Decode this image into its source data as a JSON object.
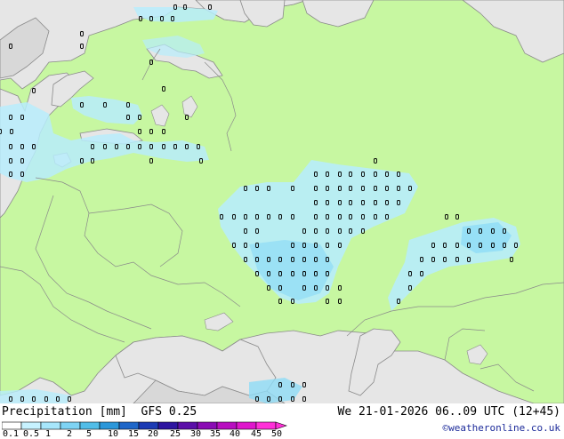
{
  "map": {
    "title": "Precipitation [mm]",
    "model": "GFS 0.25",
    "valid_time": "We 21-01-2026 06..09 UTC (12+45)",
    "credit": "©weatheronline.co.uk",
    "colors": {
      "land": "#c7f7a1",
      "sea": "#e6e6e6",
      "nodata_land": "#d8d8d8",
      "border": "#8a8a8a",
      "precip_light": "#b7ecfb",
      "precip_medium": "#8fdcf6",
      "marker": "#000000"
    },
    "legend": {
      "labels": [
        "0.1",
        "0.5",
        "1",
        "2",
        "5",
        "10",
        "15",
        "20",
        "25",
        "30",
        "35",
        "40",
        "45",
        "50"
      ],
      "colors": [
        "#ffffff",
        "#c7f2ff",
        "#a7e6fb",
        "#7ed3f4",
        "#52bde8",
        "#2b97da",
        "#1e66c8",
        "#1c3bb4",
        "#2e15a0",
        "#5b0fa8",
        "#8a0cb4",
        "#b80ec0",
        "#df16cc",
        "#ff30d8"
      ]
    }
  }
}
